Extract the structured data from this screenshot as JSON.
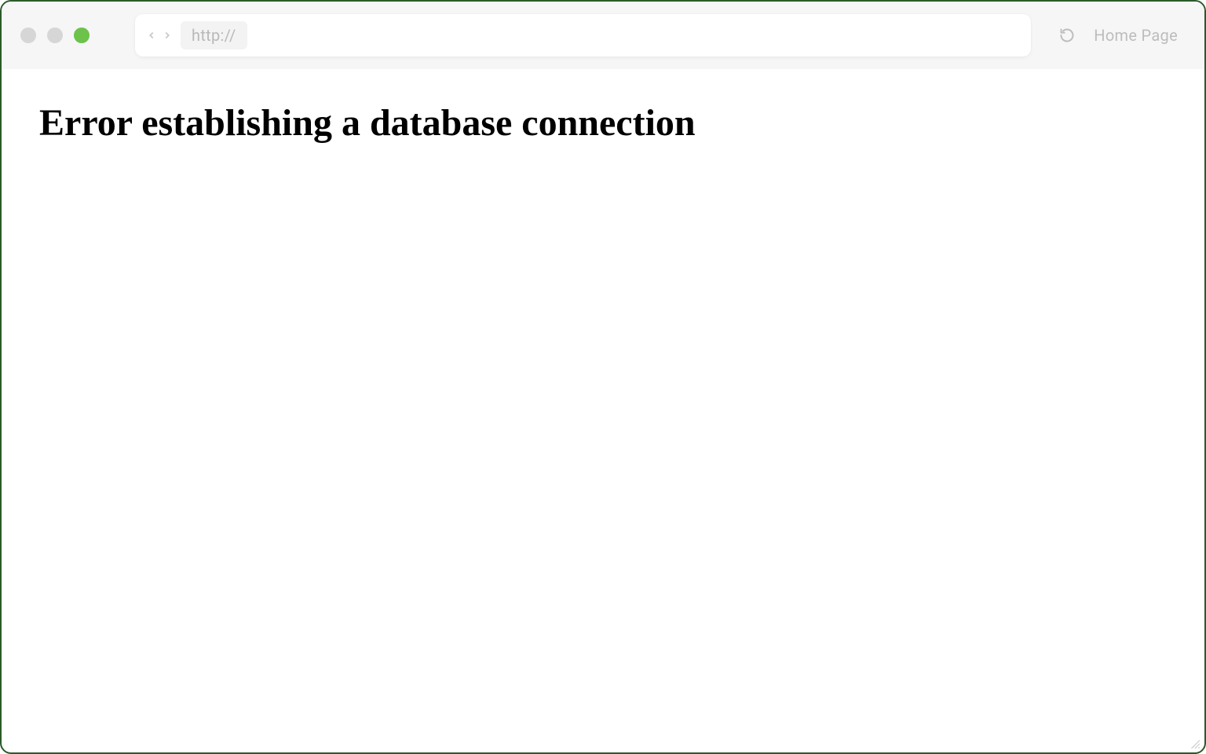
{
  "browser": {
    "url_prefix": "http://",
    "home_label": "Home Page"
  },
  "page": {
    "error_title": "Error establishing a database connection"
  },
  "colors": {
    "frame_border": "#2a5a2a",
    "chrome_bg": "#f6f6f6",
    "dot_gray": "#d6d6d6",
    "dot_green": "#6cc24a",
    "muted_text": "#bdbdbd"
  }
}
